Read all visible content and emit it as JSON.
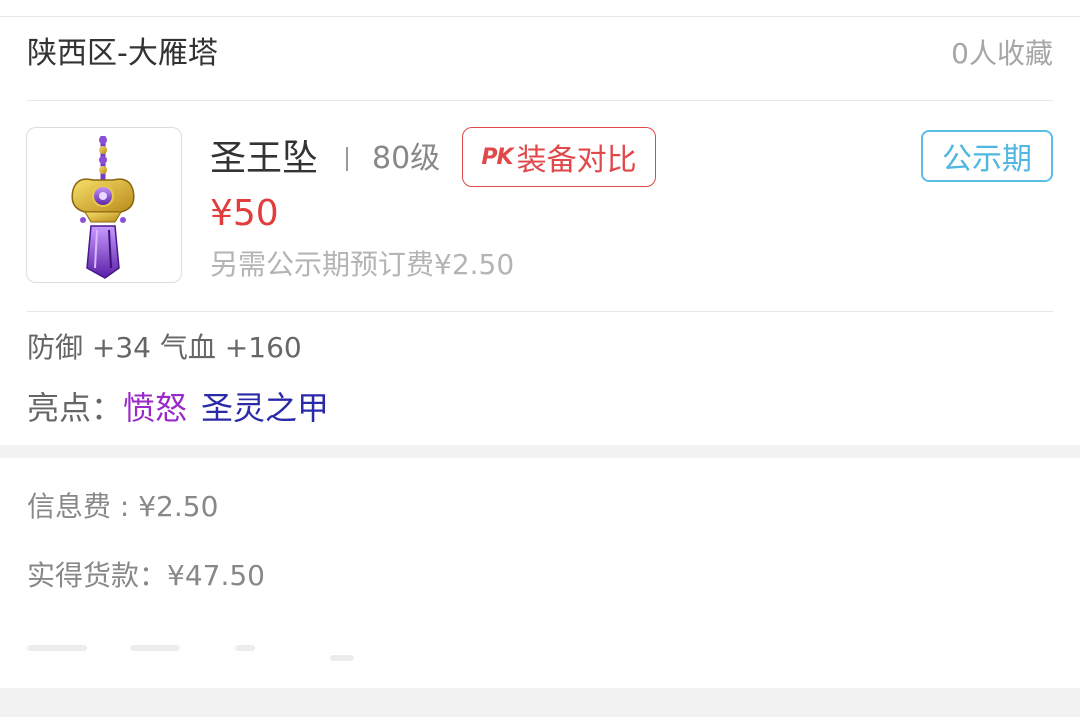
{
  "listing": {
    "server": "陕西区-大雁塔",
    "favorites": "0人收藏",
    "item_name": "圣王坠",
    "level": "80级",
    "pk_logo": "PK",
    "pk_compare": "装备对比",
    "status": "公示期",
    "price": "¥50",
    "extra_fee": "另需公示期预订费¥2.50",
    "attributes": "防御 +34 气血 +160",
    "highlights_label": "亮点：",
    "highlights": [
      "愤怒",
      "圣灵之甲"
    ]
  },
  "fees": {
    "info_fee": "信息费 : ¥2.50",
    "net_amount": "实得货款：¥47.50"
  },
  "colors": {
    "price": "#e23d3d",
    "pk": "#e0484a",
    "status": "#5bbfe5",
    "highlight_1": "#9b29c8",
    "highlight_2": "#2a2aa8"
  },
  "icons": {
    "item_image": "purple-gold-pendant-icon"
  }
}
